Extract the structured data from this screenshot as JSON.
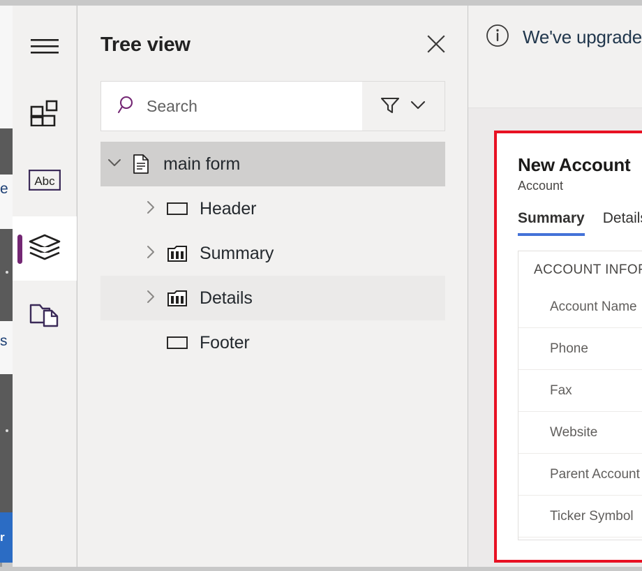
{
  "colors": {
    "accent_purple": "#742774",
    "tab_underline_blue": "#4472d8",
    "highlight_red": "#e81123",
    "panel_bg": "#f2f1f0",
    "selected_row": "#d0cfce",
    "hover_row": "#ebeae9",
    "background_blue_button": "#2b6cc4"
  },
  "background": {
    "clipped_texts": [
      "e",
      "s"
    ],
    "blue_button_label": "r"
  },
  "rail": {
    "items": [
      {
        "name": "hamburger-menu",
        "icon": "hamburger-icon",
        "selected": false
      },
      {
        "name": "components",
        "icon": "components-icon",
        "selected": false
      },
      {
        "name": "text-fields",
        "icon": "abc-icon",
        "label": "Abc",
        "selected": false
      },
      {
        "name": "tree-view",
        "icon": "layers-icon",
        "selected": true
      },
      {
        "name": "pages",
        "icon": "pages-icon",
        "selected": false
      }
    ]
  },
  "tree_panel": {
    "title": "Tree view",
    "close_icon": "close-icon",
    "search": {
      "icon": "search-icon",
      "placeholder": "Search",
      "value": ""
    },
    "filter": {
      "filter_icon": "filter-icon",
      "chevron_icon": "chevron-down-icon"
    },
    "nodes": [
      {
        "label": "main form",
        "icon": "document-icon",
        "chevron": "chevron-down",
        "indent": 0,
        "state": "selected"
      },
      {
        "label": "Header",
        "icon": "rectangle-icon",
        "chevron": "chevron-right",
        "indent": 1,
        "state": "normal"
      },
      {
        "label": "Summary",
        "icon": "columns-icon",
        "chevron": "chevron-right",
        "indent": 1,
        "state": "normal"
      },
      {
        "label": "Details",
        "icon": "columns-icon",
        "chevron": "chevron-right",
        "indent": 1,
        "state": "hover"
      },
      {
        "label": "Footer",
        "icon": "rectangle-icon",
        "chevron": "none",
        "indent": 1,
        "state": "normal"
      }
    ]
  },
  "info_bar": {
    "icon": "info-icon",
    "text": "We've upgraded"
  },
  "form_preview": {
    "title": "New Account",
    "subtitle": "Account",
    "tabs": [
      {
        "label": "Summary",
        "active": true
      },
      {
        "label": "Details",
        "active": false
      }
    ],
    "section_title": "ACCOUNT INFOR",
    "fields": [
      {
        "label": "Account Name"
      },
      {
        "label": "Phone"
      },
      {
        "label": "Fax"
      },
      {
        "label": "Website"
      },
      {
        "label": "Parent Account"
      },
      {
        "label": "Ticker Symbol"
      }
    ]
  }
}
